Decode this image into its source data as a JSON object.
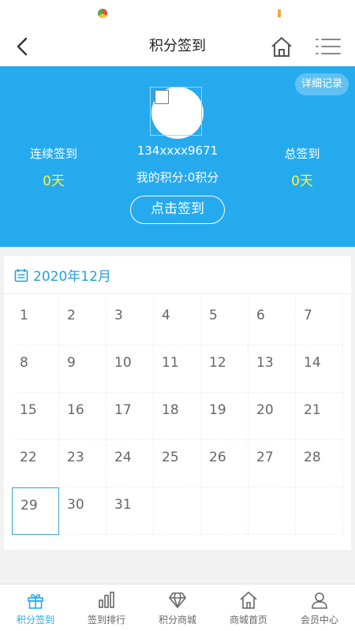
{
  "navbar": {
    "title": "积分签到"
  },
  "hero": {
    "detail_label": "详细记录",
    "streak_label": "连续签到",
    "streak_value": "0天",
    "total_label": "总签到",
    "total_value": "0天",
    "phone": "134xxxx9671",
    "points": "我的积分:0积分",
    "checkin_label": "点击签到"
  },
  "calendar": {
    "month": "2020年12月",
    "days": [
      "1",
      "2",
      "3",
      "4",
      "5",
      "6",
      "7",
      "8",
      "9",
      "10",
      "11",
      "12",
      "13",
      "14",
      "15",
      "16",
      "17",
      "18",
      "19",
      "20",
      "21",
      "22",
      "23",
      "24",
      "25",
      "26",
      "27",
      "28",
      "29",
      "30",
      "31"
    ],
    "today": "29"
  },
  "tabs": [
    {
      "label": "积分签到",
      "icon": "gift-icon",
      "active": true
    },
    {
      "label": "签到排行",
      "icon": "bar-chart-icon",
      "active": false
    },
    {
      "label": "积分商城",
      "icon": "diamond-icon",
      "active": false
    },
    {
      "label": "商城首页",
      "icon": "home-icon",
      "active": false
    },
    {
      "label": "会员中心",
      "icon": "user-icon",
      "active": false
    }
  ],
  "colors": {
    "accent": "#26aaee",
    "highlight": "#f7f54a",
    "today_border": "#3aa6d4"
  }
}
